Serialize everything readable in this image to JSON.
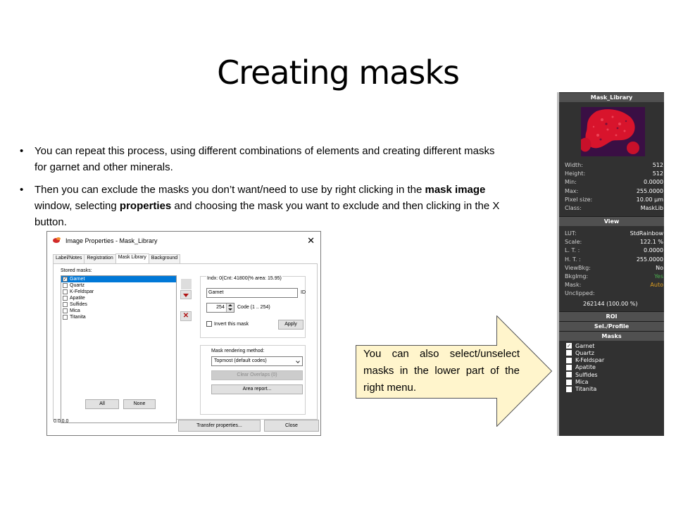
{
  "slide": {
    "title": "Creating masks",
    "bullets": [
      {
        "parts": [
          {
            "text": "You can repeat this process, using different combinations of elements and creating different masks for garnet and other minerals.",
            "bold": false
          }
        ]
      },
      {
        "parts": [
          {
            "text": "Then you can exclude the masks you don’t want/need to use by right clicking in the ",
            "bold": false
          },
          {
            "text": "mask image",
            "bold": true
          },
          {
            "text": " window, selecting ",
            "bold": false
          },
          {
            "text": "properties",
            "bold": true
          },
          {
            "text": " and choosing the mask you want to exclude and then clicking in the X button.",
            "bold": false
          }
        ]
      }
    ]
  },
  "dialog": {
    "title": "Image Properties - Mask_Library",
    "tabs": [
      "Label/Notes",
      "Registration",
      "Mask Library",
      "Background"
    ],
    "active_tab": "Mask Library",
    "stored_masks_label": "Stored masks:",
    "stored_masks": [
      {
        "name": "Garnet",
        "checked": true,
        "selected": true
      },
      {
        "name": "Quartz",
        "checked": false,
        "selected": false
      },
      {
        "name": "K-Feldspar",
        "checked": false,
        "selected": false
      },
      {
        "name": "Apatite",
        "checked": false,
        "selected": false
      },
      {
        "name": "Sulfides",
        "checked": false,
        "selected": false
      },
      {
        "name": "Mica",
        "checked": false,
        "selected": false
      },
      {
        "name": "Titanita",
        "checked": false,
        "selected": false
      }
    ],
    "index_info": "Indx: 0(Cnt: 41800(% area: 15.95)",
    "mask_name_value": "Garnet",
    "id_label": "ID",
    "code_value": "254",
    "code_label": "Code (1 .. 254)",
    "invert_label": "Invert this mask",
    "apply_label": "Apply",
    "render_method_label": "Mask rendering method:",
    "render_method_value": "Topmost (default codes)",
    "clear_overlaps_label": "Clear Overlaps (0)",
    "area_report_label": "Area report...",
    "all_label": "All",
    "none_label": "None",
    "version": "0.0.0.0",
    "transfer_label": "Transfer properties...",
    "close_label": "Close",
    "close_glyph": "✕"
  },
  "callout": {
    "text": "You can also select/unselect masks in the lower part of the right menu.",
    "fill": "#fff5cc"
  },
  "right_menu": {
    "image_title": "Mask_Library",
    "info": [
      {
        "label": "Width:",
        "value": "512"
      },
      {
        "label": "Height:",
        "value": "512"
      },
      {
        "label": "Min:",
        "value": "0.0000"
      },
      {
        "label": "Max:",
        "value": "255.0000"
      },
      {
        "label": "Pixel size:",
        "value": "10.00 µm"
      },
      {
        "label": "Class:",
        "value": "MaskLib"
      }
    ],
    "view_header": "View",
    "view": [
      {
        "label": "LUT:",
        "value": "StdRainbow",
        "color": ""
      },
      {
        "label": "Scale:",
        "value": "122.1 %",
        "color": ""
      },
      {
        "label": "L. T. :",
        "value": "0.0000",
        "color": ""
      },
      {
        "label": "H. T. :",
        "value": "255.0000",
        "color": ""
      },
      {
        "label": "ViewBkg:",
        "value": "No",
        "color": ""
      },
      {
        "label": "BkgImg:",
        "value": "Yes",
        "color": "green"
      },
      {
        "label": "Mask:",
        "value": "Auto",
        "color": "orange"
      },
      {
        "label": "Unclipped:",
        "value": "",
        "color": ""
      }
    ],
    "unclipped_value": "262144 (100.00 %)",
    "roi_header": "ROI",
    "sel_profile_header": "Sel./Profile",
    "masks_header": "Masks",
    "masks": [
      {
        "name": "Garnet",
        "checked": true
      },
      {
        "name": "Quartz",
        "checked": false
      },
      {
        "name": "K-Feldspar",
        "checked": false
      },
      {
        "name": "Apatite",
        "checked": false
      },
      {
        "name": "Sulfides",
        "checked": false
      },
      {
        "name": "Mica",
        "checked": false
      },
      {
        "name": "Titanita",
        "checked": false
      }
    ],
    "accent_colors": {
      "mask_red": "#e0102a",
      "image_bg": "#3a0f44",
      "panel_bg": "#313131"
    }
  }
}
